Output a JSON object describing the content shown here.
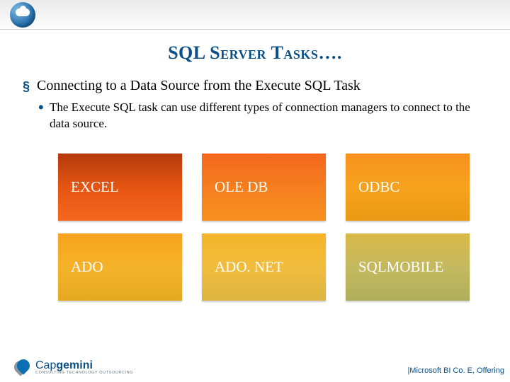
{
  "header": {
    "icon": "cloud-icon",
    "title": "SQL Server Tasks…."
  },
  "bullets": {
    "level1": "Connecting to a Data Source from the Execute SQL Task",
    "level2": "The Execute SQL task can use different types of connection managers to connect to the data source."
  },
  "tiles": [
    "EXCEL",
    "OLE DB",
    "ODBC",
    "ADO",
    "ADO. NET",
    "SQLMOBILE"
  ],
  "footer": {
    "logo_pre": "Cap",
    "logo_post": "gemini",
    "logo_tagline": "CONSULTING TECHNOLOGY OUTSOURCING",
    "right": "|Microsoft BI Co. E, Offering"
  }
}
